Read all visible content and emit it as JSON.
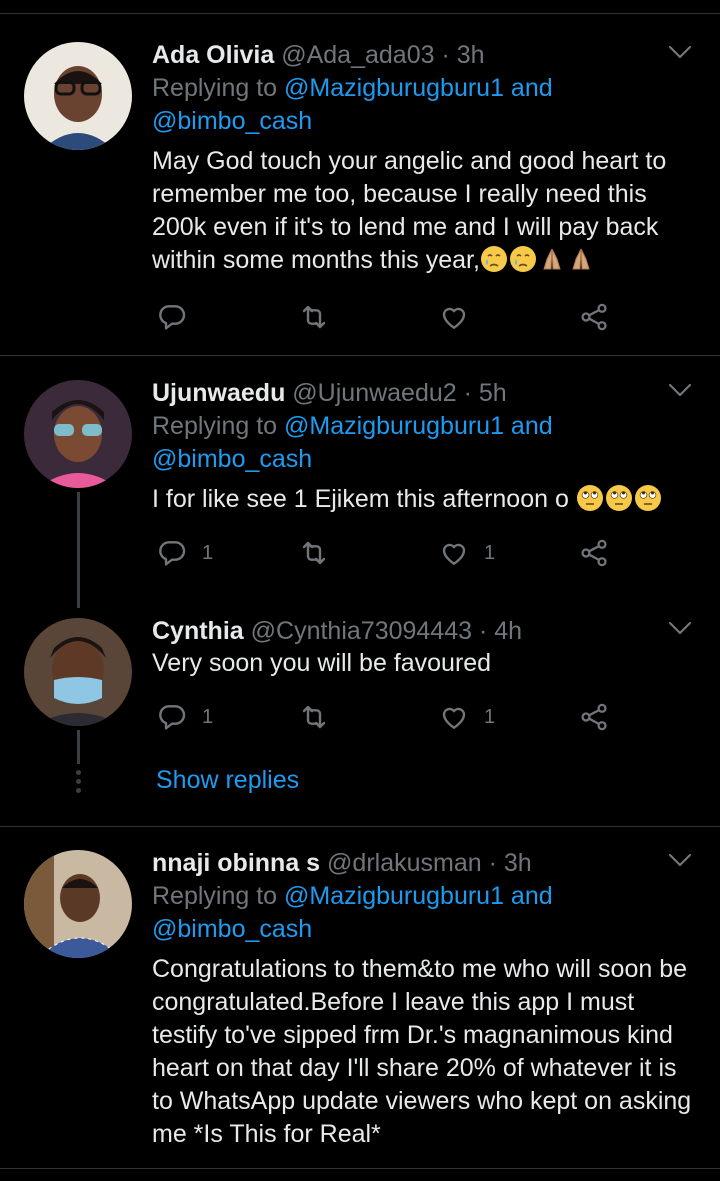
{
  "tweets": [
    {
      "name": "Ada Olivia",
      "handle": "@Ada_ada03",
      "time": "· 3h",
      "replying_prefix": "Replying to ",
      "replying_mention1": "@Mazigburugburu1",
      "replying_and": " and",
      "replying_mention2": "@bimbo_cash",
      "text": "May God touch your angelic and good  heart to remember me too, because I really need this 200k even if it's to lend me and I will pay back within some months this year,",
      "reply_count": "",
      "like_count": ""
    },
    {
      "name": "Ujunwaedu",
      "handle": "@Ujunwaedu2",
      "time": "· 5h",
      "replying_prefix": "Replying to ",
      "replying_mention1": "@Mazigburugburu1",
      "replying_and": " and",
      "replying_mention2": "@bimbo_cash",
      "text": "I for like see 1 Ejikem this afternoon o ",
      "reply_count": "1",
      "like_count": "1"
    },
    {
      "name": "Cynthia",
      "handle": "@Cynthia73094443",
      "time": "· 4h",
      "text": "Very soon you will be favoured",
      "reply_count": "1",
      "like_count": "1",
      "show_replies": "Show replies"
    },
    {
      "name": "nnaji obinna s",
      "handle": "@drlakusman",
      "time": "· 3h",
      "replying_prefix": "Replying to ",
      "replying_mention1": "@Mazigburugburu1",
      "replying_and": " and",
      "replying_mention2": "@bimbo_cash",
      "text": "Congratulations to them&to me who will soon be congratulated.Before I leave this app I must testify to've sipped frm Dr.'s magnanimous kind heart on that day I'll share 20% of whatever it is to WhatsApp update viewers who kept on asking me *Is This for Real*"
    }
  ],
  "colors": {
    "background": "#000000",
    "text": "#e7e9ea",
    "secondary": "#71767b",
    "accent": "#1d9bf0",
    "divider": "#2f3336"
  },
  "icons": [
    "reply-icon",
    "retweet-icon",
    "like-icon",
    "share-icon",
    "chevron-down-icon"
  ]
}
